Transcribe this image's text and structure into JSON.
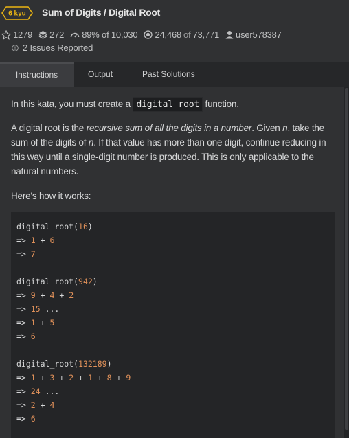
{
  "header": {
    "kyu": "6 kyu",
    "title": "Sum of Digits / Digital Root",
    "stars": "1279",
    "votes": "272",
    "satisfaction": "89% of 10,030",
    "completed": "24,468",
    "completed_of": "of",
    "warriors": "73,771",
    "author": "user578387",
    "issues": "2 Issues Reported"
  },
  "tabs": [
    {
      "label": "Instructions",
      "active": true
    },
    {
      "label": "Output",
      "active": false
    },
    {
      "label": "Past Solutions",
      "active": false
    }
  ],
  "instructions": {
    "p1_before": "In this kata, you must create a",
    "p1_code": "digital root",
    "p1_after": "function.",
    "p2_line1_a": "A digital root is the",
    "p2_line1_em": "recursive sum of all the digits in a number",
    "p2_line1_b": ". Given",
    "p2_line1_n": "n",
    "p2_line1_c": ", take the",
    "p2_line2_a": "sum of the digits of",
    "p2_line2_n": "n",
    "p2_line2_b": ". If that value has more than one digit, continue reducing in",
    "p2_line3": "this way until a single-digit number is produced. This is only applicable to the",
    "p2_line4": "natural numbers.",
    "p3": "Here's how it works:"
  },
  "code_example": {
    "fn": "digital_root",
    "lines": [
      [
        "digital_root(",
        "16",
        ")"
      ],
      [
        "=> ",
        "1",
        " + ",
        "6"
      ],
      [
        "=> ",
        "7"
      ],
      [],
      [
        "digital_root(",
        "942",
        ")"
      ],
      [
        "=> ",
        "9",
        " + ",
        "4",
        " + ",
        "2"
      ],
      [
        "=> ",
        "15",
        " ..."
      ],
      [
        "=> ",
        "1",
        " + ",
        "5"
      ],
      [
        "=> ",
        "6"
      ],
      [],
      [
        "digital_root(",
        "132189",
        ")"
      ],
      [
        "=> ",
        "1",
        " + ",
        "3",
        " + ",
        "2",
        " + ",
        "1",
        " + ",
        "8",
        " + ",
        "9"
      ],
      [
        "=> ",
        "24",
        " ..."
      ],
      [
        "=> ",
        "2",
        " + ",
        "4"
      ],
      [
        "=> ",
        "6"
      ]
    ]
  },
  "colors": {
    "background": "#303133",
    "tab_bar": "#262729",
    "code_bg": "#242527",
    "kyu_yellow": "#ecb613",
    "number_orange": "#e0915a"
  }
}
